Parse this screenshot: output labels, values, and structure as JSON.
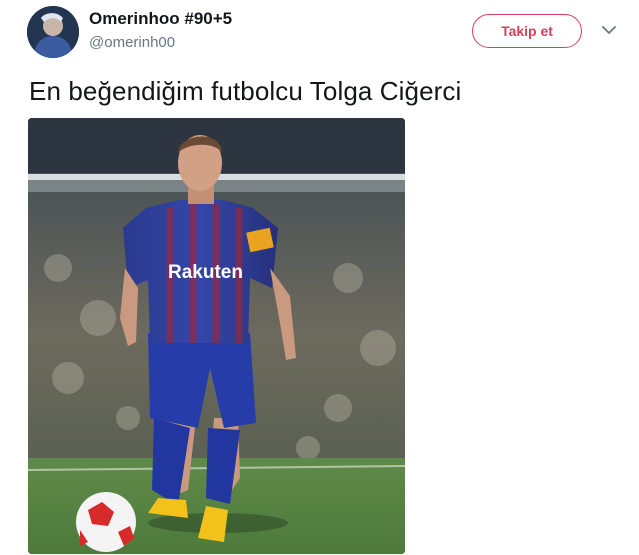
{
  "user": {
    "display_name": "Omerinhoo #90+5",
    "handle": "@omerinh00"
  },
  "follow_button": {
    "label": "Takip et"
  },
  "tweet": {
    "text": "En beğendiğim futbolcu Tolga Ciğerci"
  },
  "media": {
    "shirt_sponsor": "Rakuten"
  },
  "colors": {
    "follow_accent": "#d6405b",
    "handle_gray": "#657786"
  }
}
